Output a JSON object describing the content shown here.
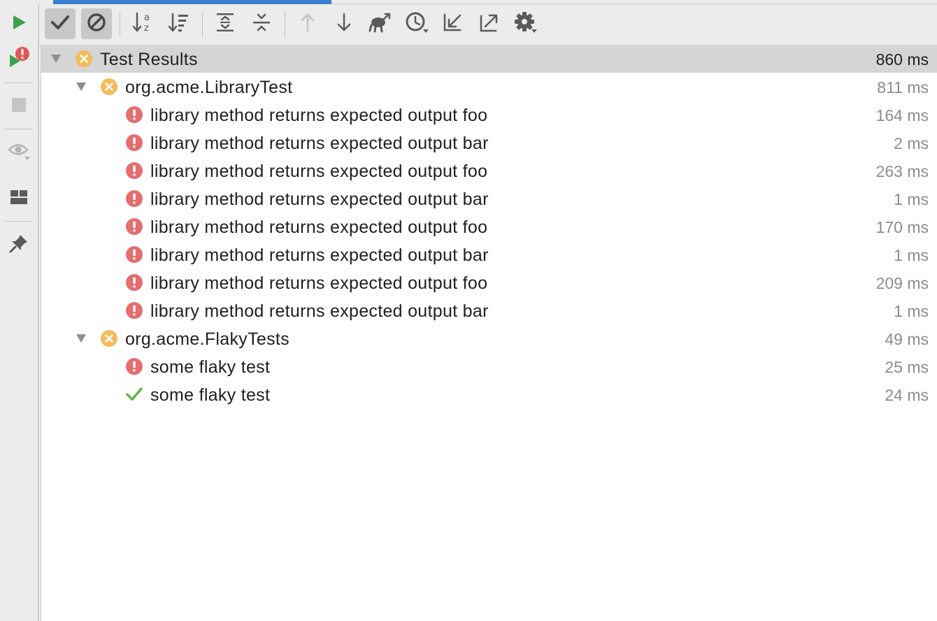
{
  "colors": {
    "accent": "#3d7fd1",
    "run_green": "#3fa14d",
    "error_red": "#e46e6e",
    "warning_orange": "#f3bb5a",
    "success_green": "#62b543",
    "icon_gray": "#5a5a5a",
    "disabled_gray": "#b4b4b4"
  },
  "side_toolbar": {
    "items": [
      {
        "name": "rerun",
        "icon": "play-icon"
      },
      {
        "name": "rerun-failed",
        "icon": "play-error-icon"
      },
      {
        "name": "stop",
        "icon": "stop-icon"
      },
      {
        "name": "view",
        "icon": "eye-icon"
      },
      {
        "name": "layout",
        "icon": "layout-icon"
      },
      {
        "name": "pin",
        "icon": "pin-icon"
      }
    ]
  },
  "toolbar": {
    "items": [
      {
        "name": "show-passed",
        "icon": "check-icon",
        "active": true
      },
      {
        "name": "show-ignored",
        "icon": "ignore-icon",
        "active": true
      },
      {
        "name": "sort-alphabetically",
        "icon": "sort-az-icon"
      },
      {
        "name": "sort-by-duration",
        "icon": "sort-duration-icon"
      },
      {
        "name": "expand-all",
        "icon": "expand-all-icon"
      },
      {
        "name": "collapse-all",
        "icon": "collapse-all-icon"
      },
      {
        "name": "previous-failed",
        "icon": "arrow-up-icon",
        "disabled": true
      },
      {
        "name": "next-failed",
        "icon": "arrow-down-icon"
      },
      {
        "name": "import-tests",
        "icon": "import-icon"
      },
      {
        "name": "test-history",
        "icon": "history-icon"
      },
      {
        "name": "import-from-file",
        "icon": "import-arrow-icon"
      },
      {
        "name": "export",
        "icon": "export-icon"
      },
      {
        "name": "settings",
        "icon": "gear-icon"
      }
    ]
  },
  "tree": {
    "rows": [
      {
        "label": "Test Results",
        "duration": "860 ms",
        "status": "failed-suite",
        "level": 0,
        "expanded": true,
        "selected": true
      },
      {
        "label": "org.acme.LibraryTest",
        "duration": "811 ms",
        "status": "failed-suite",
        "level": 1,
        "expanded": true
      },
      {
        "label": "library method returns expected output foo",
        "duration": "164 ms",
        "status": "error",
        "level": 2
      },
      {
        "label": "library method returns expected output bar",
        "duration": "2 ms",
        "status": "error",
        "level": 2
      },
      {
        "label": "library method returns expected output foo",
        "duration": "263 ms",
        "status": "error",
        "level": 2
      },
      {
        "label": "library method returns expected output bar",
        "duration": "1 ms",
        "status": "error",
        "level": 2
      },
      {
        "label": "library method returns expected output foo",
        "duration": "170 ms",
        "status": "error",
        "level": 2
      },
      {
        "label": "library method returns expected output bar",
        "duration": "1 ms",
        "status": "error",
        "level": 2
      },
      {
        "label": "library method returns expected output foo",
        "duration": "209 ms",
        "status": "error",
        "level": 2
      },
      {
        "label": "library method returns expected output bar",
        "duration": "1 ms",
        "status": "error",
        "level": 2
      },
      {
        "label": "org.acme.FlakyTests",
        "duration": "49 ms",
        "status": "failed-suite",
        "level": 1,
        "expanded": true
      },
      {
        "label": "some flaky test",
        "duration": "25 ms",
        "status": "error",
        "level": 2
      },
      {
        "label": "some flaky test",
        "duration": "24 ms",
        "status": "passed",
        "level": 2
      }
    ]
  }
}
